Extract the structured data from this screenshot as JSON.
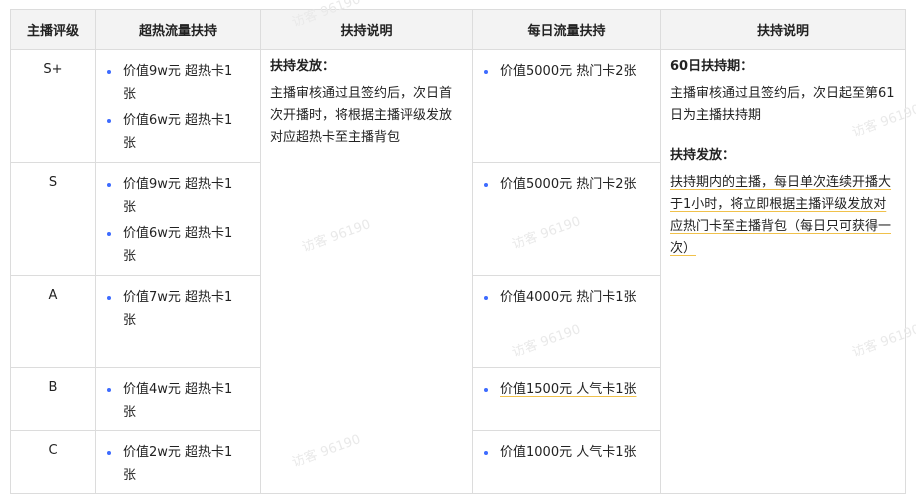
{
  "headers": [
    "主播评级",
    "超热流量扶持",
    "扶持说明",
    "每日流量扶持",
    "扶持说明"
  ],
  "rows": [
    {
      "grade": "S+",
      "hot": [
        "价值9w元 超热卡1张",
        "价值6w元 超热卡1张"
      ],
      "daily": [
        "价值5000元 热门卡2张"
      ]
    },
    {
      "grade": "S",
      "hot": [
        "价值9w元 超热卡1张",
        "价值6w元 超热卡1张"
      ],
      "daily": [
        "价值5000元 热门卡2张"
      ]
    },
    {
      "grade": "A",
      "hot": [
        "价值7w元 超热卡1张"
      ],
      "daily": [
        "价值4000元 热门卡1张"
      ]
    },
    {
      "grade": "B",
      "hot": [
        "价值4w元 超热卡1张"
      ],
      "daily": [
        "价值1500元 人气卡1张"
      ]
    },
    {
      "grade": "C",
      "hot": [
        "价值2w元 超热卡1张"
      ],
      "daily": [
        "价值1000元 人气卡1张"
      ]
    }
  ],
  "desc1": {
    "title": "扶持发放：",
    "body": "主播审核通过且签约后，次日首次开播时，将根据主播评级发放对应超热卡至主播背包"
  },
  "desc2": {
    "title1": "60日扶持期：",
    "body1": "主播审核通过且签约后，次日起至第61日为主播扶持期",
    "title2": "扶持发放：",
    "body2": "扶持期内的主播，每日单次连续开播大于1小时，将立即根据主播评级发放对应热门卡至主播背包（每日只可获得一次）"
  },
  "watermark": "访客 96190"
}
